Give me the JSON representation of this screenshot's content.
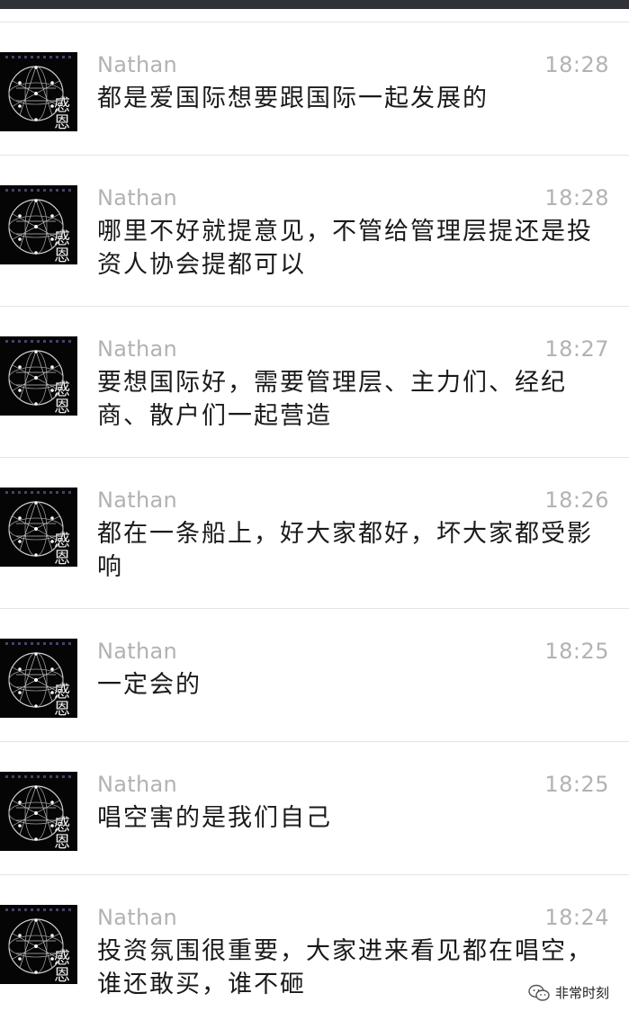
{
  "messages": [
    {
      "sender": "Nathan",
      "time": "18:28",
      "text": "都是爱国际想要跟国际一起发展的"
    },
    {
      "sender": "Nathan",
      "time": "18:28",
      "text": "哪里不好就提意见，不管给管理层提还是投资人协会提都可以"
    },
    {
      "sender": "Nathan",
      "time": "18:27",
      "text": "要想国际好，需要管理层、主力们、经纪商、散户们一起营造"
    },
    {
      "sender": "Nathan",
      "time": "18:26",
      "text": "都在一条船上，好大家都好，坏大家都受影响"
    },
    {
      "sender": "Nathan",
      "time": "18:25",
      "text": "一定会的"
    },
    {
      "sender": "Nathan",
      "time": "18:25",
      "text": "唱空害的是我们自己"
    },
    {
      "sender": "Nathan",
      "time": "18:24",
      "text": "投资氛围很重要，大家进来看见都在唱空，谁还敢买，谁不砸"
    }
  ],
  "avatar": {
    "caption": "感恩",
    "icon": "geodesic-sphere-icon"
  },
  "watermark": {
    "text": "非常时刻",
    "icon": "wechat-icon"
  },
  "colors": {
    "topbar": "#2f3236",
    "meta": "#b2b2b2",
    "text": "#1a1a1a",
    "divider": "#e4e4e4"
  }
}
